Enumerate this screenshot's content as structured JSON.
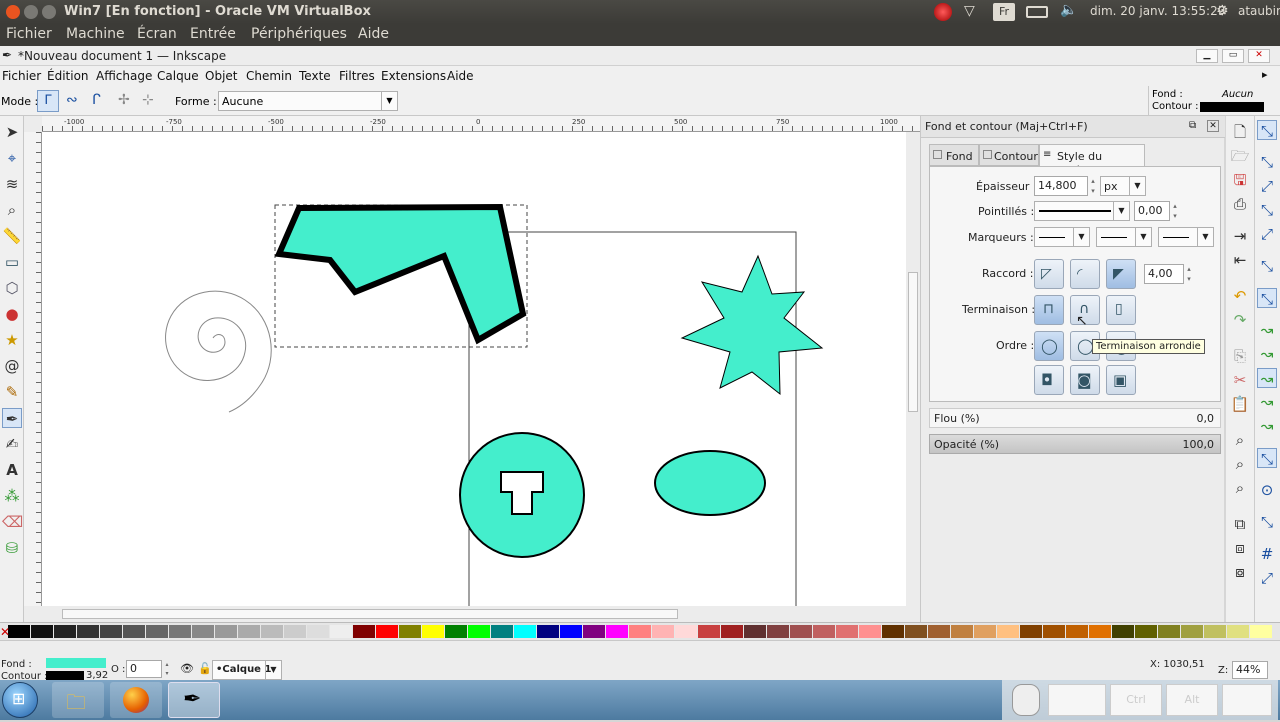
{
  "vbox": {
    "title": "Win7 [En fonction] - Oracle VM VirtualBox",
    "menu": [
      "Fichier",
      "Machine",
      "Écran",
      "Entrée",
      "Périphériques",
      "Aide"
    ],
    "clock": "dim. 20 janv. 13:55:29",
    "user": "ataubin",
    "keyboard": "Fr"
  },
  "inkscape": {
    "title": "*Nouveau document 1 — Inkscape",
    "menu": [
      "Fichier",
      "Édition",
      "Affichage",
      "Calque",
      "Objet",
      "Chemin",
      "Texte",
      "Filtres",
      "Extensions",
      "Aide"
    ],
    "mode_label": "Mode :",
    "forme_label": "Forme :",
    "forme_value": "Aucune",
    "fill_label": "Fond :",
    "fill_value": "Aucun",
    "stroke_label": "Contour :",
    "ruler_ticks": [
      "-1000",
      "-750",
      "-500",
      "-250",
      "0",
      "250",
      "500",
      "750",
      "1000"
    ]
  },
  "panel": {
    "title": "Fond et contour (Maj+Ctrl+F)",
    "tabs": [
      "Fond",
      "Contour",
      "Style du contour"
    ],
    "epaisseur_label": "Épaisseur :",
    "epaisseur_value": "14,800",
    "unit_value": "px",
    "pointilles_label": "Pointillés :",
    "pointilles_offset": "0,00",
    "marqueurs_label": "Marqueurs :",
    "raccord_label": "Raccord :",
    "raccord_limit": "4,00",
    "terminaison_label": "Terminaison :",
    "ordre_label": "Ordre :",
    "tooltip": "Terminaison arrondie",
    "flou_label": "Flou (%)",
    "flou_value": "0,0",
    "opacite_label": "Opacité (%)",
    "opacite_value": "100,0"
  },
  "status": {
    "fond_label": "Fond :",
    "contour_label": "Contour :",
    "stroke_width": "3,92",
    "opacity_label": "O :",
    "opacity_value": "0",
    "layer": "•Calque 1",
    "coords": "X: 1030,51",
    "zoom_label": "Z:",
    "zoom_value": "44%"
  },
  "taskbar": {
    "items": [
      "start-orb",
      "file-explorer",
      "firefox",
      "inkscape"
    ],
    "keys": [
      "Ctrl",
      "Alt"
    ]
  },
  "colors": {
    "shape_fill": "#44eecc",
    "stroke": "#000000",
    "tooltip_bg": "#ffffe1"
  }
}
